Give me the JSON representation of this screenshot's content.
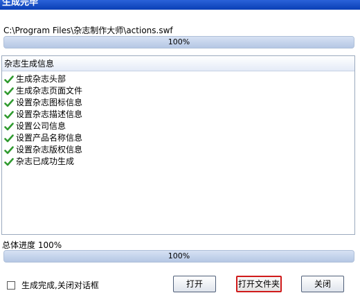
{
  "window": {
    "title": "生成完毕"
  },
  "file": {
    "path": "C:\\Program Files\\杂志制作大师\\actions.swf"
  },
  "file_progress": {
    "value": 100,
    "text": "100%"
  },
  "log": {
    "header": "杂志生成信息",
    "items": [
      "生成杂志头部",
      "生成杂志页面文件",
      "设置杂志图标信息",
      "设置杂志描述信息",
      "设置公司信息",
      "设置产品名称信息",
      "设置杂志版权信息",
      "杂志已成功生成"
    ],
    "item_icon": "check-icon",
    "icon_color": "#2f9a2f"
  },
  "total": {
    "label": "总体进度 100%",
    "value": 100,
    "text": "100%"
  },
  "option": {
    "label": "生成完成,关闭对话框",
    "checked": false
  },
  "buttons": {
    "open": "打开",
    "open_folder": "打开文件夹",
    "close": "关闭"
  },
  "colors": {
    "titlebar": "#0a3fb5",
    "highlight": "#d01a1a"
  }
}
